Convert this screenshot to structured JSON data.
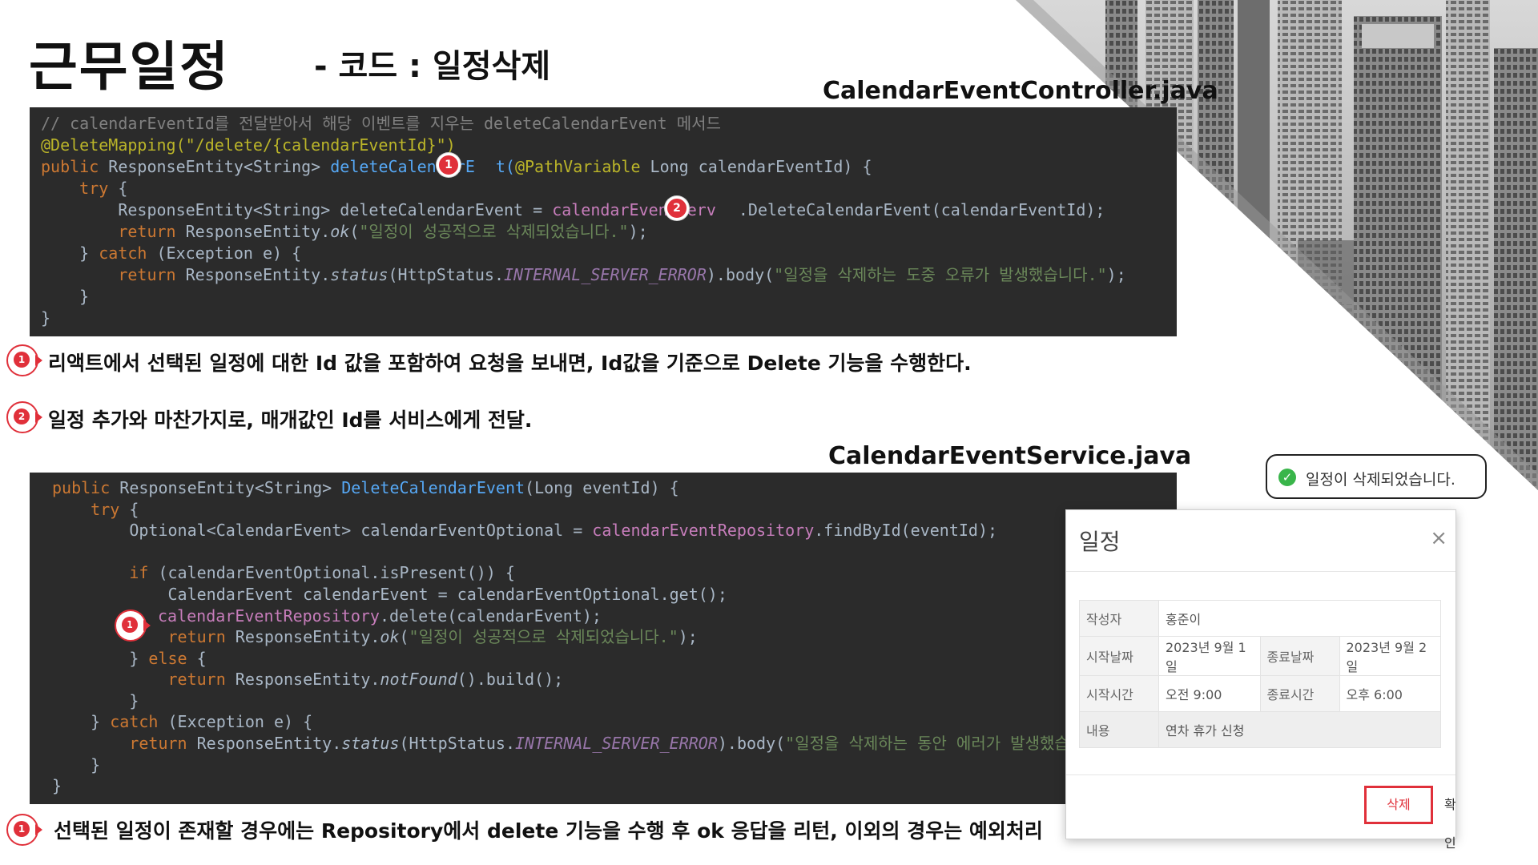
{
  "title": "근무일정",
  "subtitle": "- 코드 : 일정삭제",
  "files": {
    "controller": "CalendarEventController.java",
    "service": "CalendarEventService.java"
  },
  "code1": {
    "l1": "// calendarEventId를 전달받아서 해당 이벤트를 지우는 deleteCalendarEvent 메서드",
    "l2": "@DeleteMapping(\"/delete/{calendarEventId}\")",
    "l3a": "public ",
    "l3b": "ResponseEntity<String> ",
    "l3c": "deleteCalendarE",
    "l3d": "t(",
    "l3e": "@PathVariable ",
    "l3f": "Long calendarEventId) {",
    "l4a": "    try ",
    "l4b": "{",
    "l5a": "        ResponseEntity<String> deleteCalendarEvent = ",
    "l5b": "calendarEventServ",
    "l5c": ".DeleteCalendarEvent(calendarEventId);",
    "l6a": "        return ",
    "l6b": "ResponseEntity.",
    "l6c": "ok",
    "l6d": "(",
    "l6e": "\"일정이 성공적으로 삭제되었습니다.\"",
    "l6f": ");",
    "l7a": "    } ",
    "l7b": "catch ",
    "l7c": "(Exception e) {",
    "l8a": "        return ",
    "l8b": "ResponseEntity.",
    "l8c": "status",
    "l8d": "(HttpStatus.",
    "l8e": "INTERNAL_SERVER_ERROR",
    "l8f": ").body(",
    "l8g": "\"일정을 삭제하는 도중 오류가 발생했습니다.\"",
    "l8h": ");",
    "l9": "    }",
    "l10": "}"
  },
  "code2": {
    "l1a": "public ",
    "l1b": "ResponseEntity<String> ",
    "l1c": "DeleteCalendarEvent",
    "l1d": "(Long eventId) {",
    "l2a": "    try ",
    "l2b": "{",
    "l3a": "        Optional<CalendarEvent> calendarEventOptional = ",
    "l3b": "calendarEventRepository",
    "l3c": ".findById(eventId);",
    "l5a": "        if ",
    "l5b": "(calendarEventOptional.isPresent()) {",
    "l6": "            CalendarEvent calendarEvent = calendarEventOptional.get();",
    "l7a": "calendarEventRepository",
    "l7b": ".delete(calendarEvent);",
    "l8a": "            return ",
    "l8b": "ResponseEntity.",
    "l8c": "ok",
    "l8d": "(",
    "l8e": "\"일정이 성공적으로 삭제되었습니다.\"",
    "l8f": ");",
    "l9a": "        } ",
    "l9b": "else ",
    "l9c": "{",
    "l10a": "            return ",
    "l10b": "ResponseEntity.",
    "l10c": "notFound",
    "l10d": "().build();",
    "l11": "        }",
    "l12a": "    } ",
    "l12b": "catch ",
    "l12c": "(Exception e) {",
    "l13a": "        return ",
    "l13b": "ResponseEntity.",
    "l13c": "status",
    "l13d": "(HttpStatus.",
    "l13e": "INTERNAL_SERVER_ERROR",
    "l13f": ").body(",
    "l13g": "\"일정을 삭제하는 동안 에러가 발생했습니",
    "l14": "    }",
    "l15": "}"
  },
  "badges": {
    "one": "1",
    "two": "2"
  },
  "notes": {
    "n1": "리액트에서 선택된 일정에 대한 Id 값을 포함하여 요청을 보내면, Id값을 기준으로 Delete 기능을 수행한다.",
    "n2": "일정 추가와 마찬가지로, 매개값인 Id를 서비스에게 전달.",
    "n3": "선택된 일정이 존재할 경우에는 Repository에서 delete 기능을 수행 후 ok 응답을 리턴, 이외의 경우는 예외처리"
  },
  "toast": {
    "message": "일정이 삭제되었습니다.",
    "icon": "check-circle-icon",
    "color": "#39b54a"
  },
  "modal": {
    "title": "일정",
    "close": "×",
    "author_label": "작성자",
    "author": "홍준이",
    "start_date_label": "시작날짜",
    "start_date": "2023년 9월 1일",
    "end_date_label": "종료날짜",
    "end_date": "2023년 9월 2일",
    "start_time_label": "시작시간",
    "start_time": "오전 9:00",
    "end_time_label": "종료시간",
    "end_time": "오후 6:00",
    "content_label": "내용",
    "content": "연차 휴가 신청",
    "delete_button": "삭제",
    "ok_button": "확인",
    "accent": "#e0303a"
  }
}
